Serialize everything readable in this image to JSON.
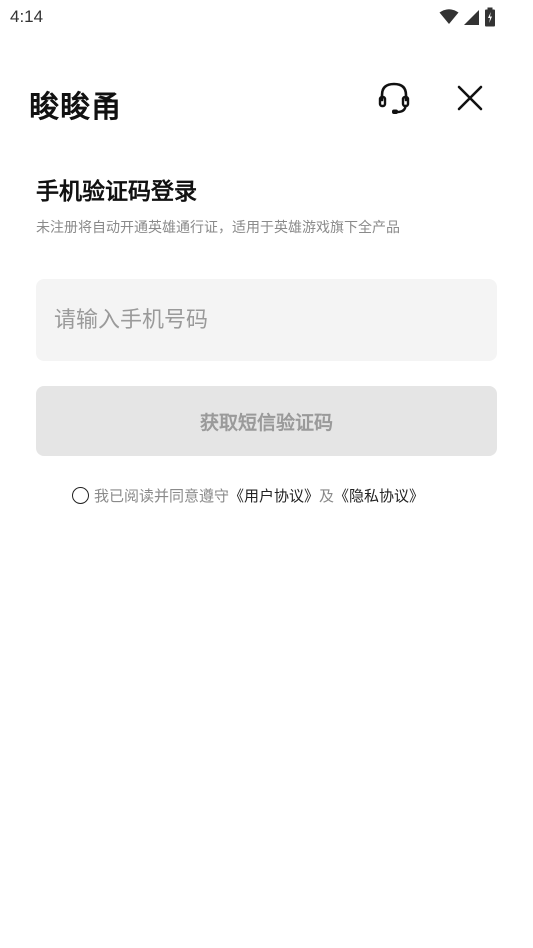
{
  "status_bar": {
    "time": "4:14",
    "icons": [
      "wifi-icon",
      "signal-icon",
      "battery-icon"
    ]
  },
  "header": {
    "brand": "睃睃甬",
    "support_icon": "headset-icon",
    "close_icon": "close-icon"
  },
  "login": {
    "title": "手机验证码登录",
    "subtitle": "未注册将自动开通英雄通行证，适用于英雄游戏旗下全产品",
    "phone_placeholder": "请输入手机号码",
    "phone_value": "",
    "get_code_label": "获取短信验证码"
  },
  "agreement": {
    "checked": false,
    "prefix": "我已阅读并同意遵守",
    "user_agreement": "《用户协议》",
    "conjunction": "及",
    "privacy_policy": "《隐私协议》"
  },
  "colors": {
    "background": "#ffffff",
    "input_bg": "#f4f4f4",
    "button_disabled_bg": "#e5e5e5",
    "button_disabled_text": "#9a9a9a",
    "muted_text": "#8a8a8a",
    "primary_text": "#111111"
  }
}
